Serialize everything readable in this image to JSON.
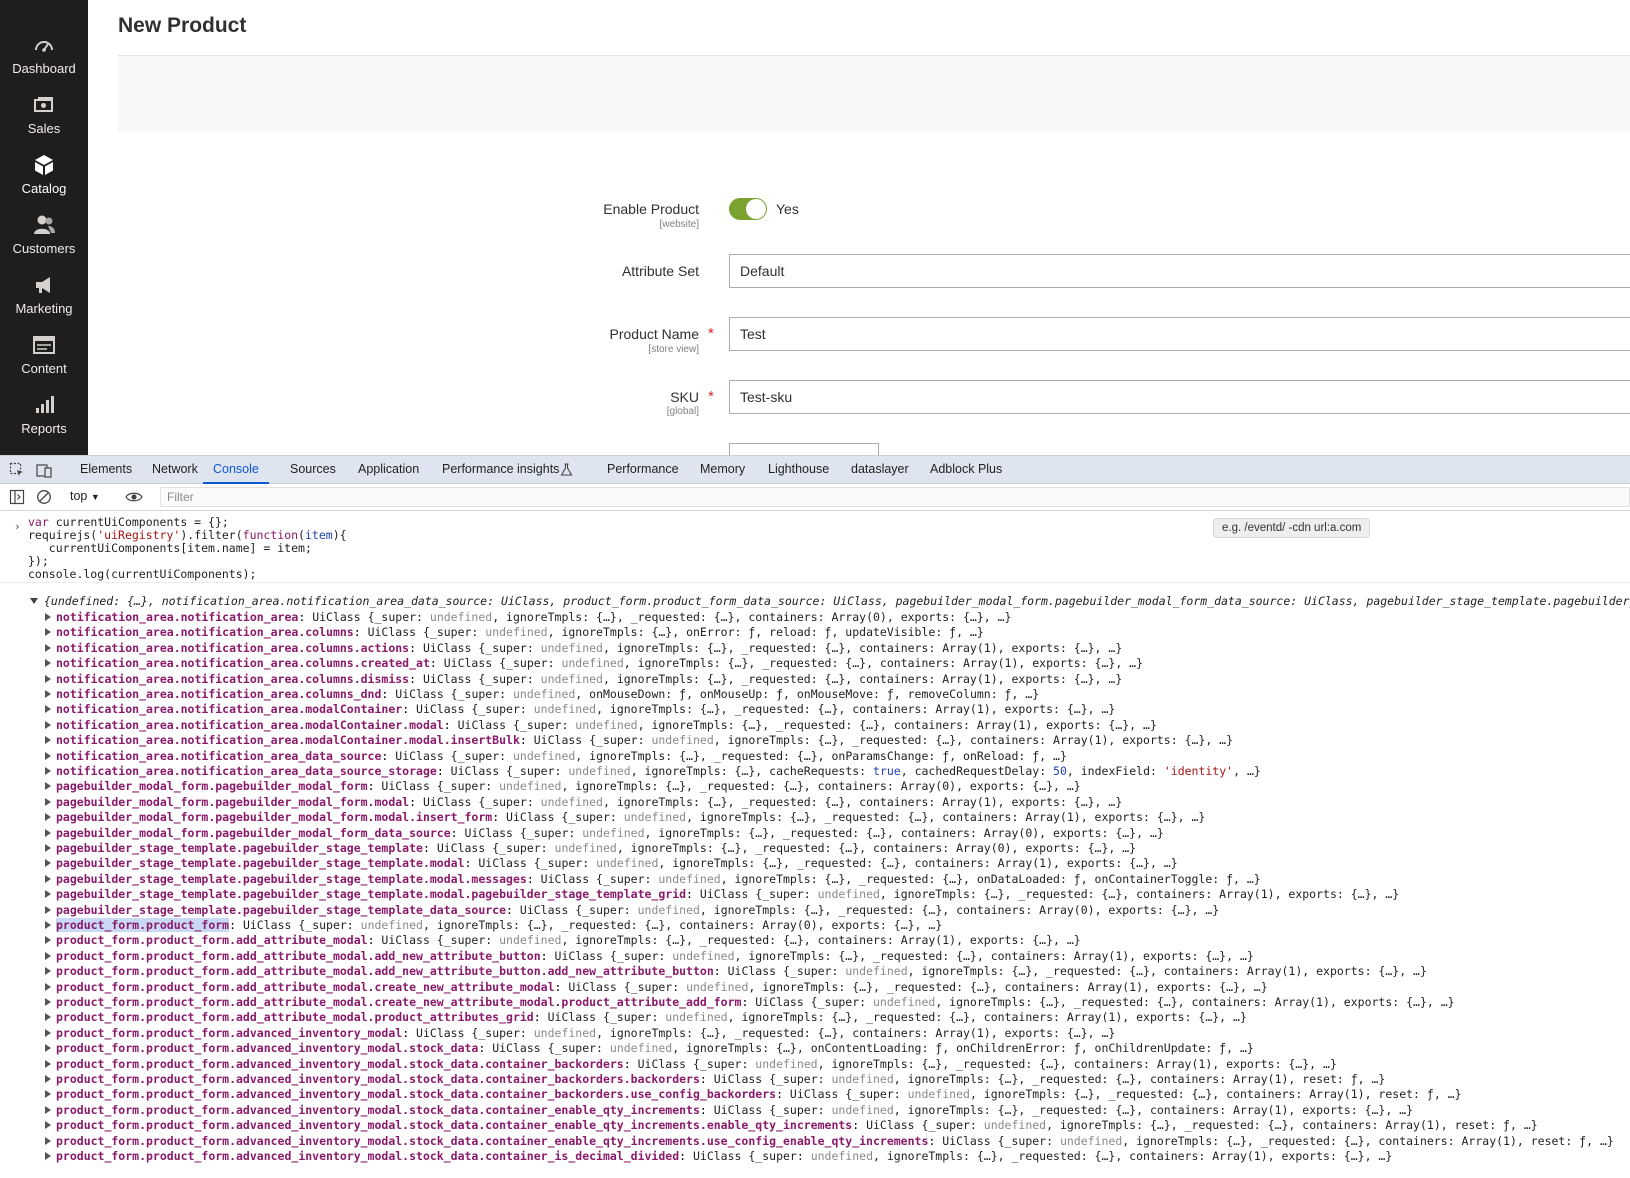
{
  "sidebar": {
    "items": [
      {
        "label": "Dashboard",
        "icon": "dashboard-icon"
      },
      {
        "label": "Sales",
        "icon": "sales-icon"
      },
      {
        "label": "Catalog",
        "icon": "catalog-icon"
      },
      {
        "label": "Customers",
        "icon": "customers-icon"
      },
      {
        "label": "Marketing",
        "icon": "marketing-icon"
      },
      {
        "label": "Content",
        "icon": "content-icon"
      },
      {
        "label": "Reports",
        "icon": "reports-icon"
      }
    ],
    "active": "Catalog"
  },
  "page": {
    "title": "New Product"
  },
  "form": {
    "enable_product": {
      "label": "Enable Product",
      "scope": "[website]",
      "value": "Yes",
      "on": true
    },
    "attribute_set": {
      "label": "Attribute Set",
      "value": "Default"
    },
    "product_name": {
      "label": "Product Name",
      "scope": "[store view]",
      "value": "Test",
      "required": "*"
    },
    "sku": {
      "label": "SKU",
      "scope": "[global]",
      "value": "Test-sku",
      "required": "*"
    }
  },
  "devtools": {
    "tabs": [
      "Elements",
      "Network",
      "Console",
      "Sources",
      "Application",
      "Performance insights",
      "Performance",
      "Memory",
      "Lighthouse",
      "dataslayer",
      "Adblock Plus"
    ],
    "active_tab": "Console",
    "context": "top",
    "filter_placeholder": "Filter",
    "filter_hint": "e.g. /eventd/ -cdn url:a.com",
    "command_lines": [
      "var currentUiComponents = {};",
      "requirejs('uiRegistry').filter(function(item){",
      "   currentUiComponents[item.name] = item;",
      "});",
      "console.log(currentUiComponents);"
    ],
    "result_summary": "{undefined: {…}, notification_area.notification_area_data_source: UiClass, product_form.product_form_data_source: UiClass, pagebuilder_modal_form.pagebuilder_modal_form_data_source: UiClass, pagebuilder_stage_template.pagebuilder_stage_temp",
    "entries": [
      {
        "key": "notification_area.notification_area",
        "value": "UiClass {_super: undefined, ignoreTmpls: {…}, _requested: {…}, containers: Array(0), exports: {…}, …}"
      },
      {
        "key": "notification_area.notification_area.columns",
        "value": "UiClass {_super: undefined, ignoreTmpls: {…}, onError: ƒ, reload: ƒ, updateVisible: ƒ, …}"
      },
      {
        "key": "notification_area.notification_area.columns.actions",
        "value": "UiClass {_super: undefined, ignoreTmpls: {…}, _requested: {…}, containers: Array(1), exports: {…}, …}"
      },
      {
        "key": "notification_area.notification_area.columns.created_at",
        "value": "UiClass {_super: undefined, ignoreTmpls: {…}, _requested: {…}, containers: Array(1), exports: {…}, …}"
      },
      {
        "key": "notification_area.notification_area.columns.dismiss",
        "value": "UiClass {_super: undefined, ignoreTmpls: {…}, _requested: {…}, containers: Array(1), exports: {…}, …}"
      },
      {
        "key": "notification_area.notification_area.columns_dnd",
        "value": "UiClass {_super: undefined, onMouseDown: ƒ, onMouseUp: ƒ, onMouseMove: ƒ, removeColumn: ƒ, …}"
      },
      {
        "key": "notification_area.notification_area.modalContainer",
        "value": "UiClass {_super: undefined, ignoreTmpls: {…}, _requested: {…}, containers: Array(1), exports: {…}, …}"
      },
      {
        "key": "notification_area.notification_area.modalContainer.modal",
        "value": "UiClass {_super: undefined, ignoreTmpls: {…}, _requested: {…}, containers: Array(1), exports: {…}, …}"
      },
      {
        "key": "notification_area.notification_area.modalContainer.modal.insertBulk",
        "value": "UiClass {_super: undefined, ignoreTmpls: {…}, _requested: {…}, containers: Array(1), exports: {…}, …}"
      },
      {
        "key": "notification_area.notification_area_data_source",
        "value": "UiClass {_super: undefined, ignoreTmpls: {…}, _requested: {…}, onParamsChange: ƒ, onReload: ƒ, …}"
      },
      {
        "key": "notification_area.notification_area_data_source_storage",
        "value": "UiClass {_super: undefined, ignoreTmpls: {…}, cacheRequests: true, cachedRequestDelay: 50, indexField: 'identity', …}"
      },
      {
        "key": "pagebuilder_modal_form.pagebuilder_modal_form",
        "value": "UiClass {_super: undefined, ignoreTmpls: {…}, _requested: {…}, containers: Array(0), exports: {…}, …}"
      },
      {
        "key": "pagebuilder_modal_form.pagebuilder_modal_form.modal",
        "value": "UiClass {_super: undefined, ignoreTmpls: {…}, _requested: {…}, containers: Array(1), exports: {…}, …}"
      },
      {
        "key": "pagebuilder_modal_form.pagebuilder_modal_form.modal.insert_form",
        "value": "UiClass {_super: undefined, ignoreTmpls: {…}, _requested: {…}, containers: Array(1), exports: {…}, …}"
      },
      {
        "key": "pagebuilder_modal_form.pagebuilder_modal_form_data_source",
        "value": "UiClass {_super: undefined, ignoreTmpls: {…}, _requested: {…}, containers: Array(0), exports: {…}, …}"
      },
      {
        "key": "pagebuilder_stage_template.pagebuilder_stage_template",
        "value": "UiClass {_super: undefined, ignoreTmpls: {…}, _requested: {…}, containers: Array(0), exports: {…}, …}"
      },
      {
        "key": "pagebuilder_stage_template.pagebuilder_stage_template.modal",
        "value": "UiClass {_super: undefined, ignoreTmpls: {…}, _requested: {…}, containers: Array(1), exports: {…}, …}"
      },
      {
        "key": "pagebuilder_stage_template.pagebuilder_stage_template.modal.messages",
        "value": "UiClass {_super: undefined, ignoreTmpls: {…}, _requested: {…}, onDataLoaded: ƒ, onContainerToggle: ƒ, …}"
      },
      {
        "key": "pagebuilder_stage_template.pagebuilder_stage_template.modal.pagebuilder_stage_template_grid",
        "value": "UiClass {_super: undefined, ignoreTmpls: {…}, _requested: {…}, containers: Array(1), exports: {…}, …}"
      },
      {
        "key": "pagebuilder_stage_template.pagebuilder_stage_template_data_source",
        "value": "UiClass {_super: undefined, ignoreTmpls: {…}, _requested: {…}, containers: Array(0), exports: {…}, …}"
      },
      {
        "key": "product_form.product_form",
        "value": "UiClass {_super: undefined, ignoreTmpls: {…}, _requested: {…}, containers: Array(0), exports: {…}, …}",
        "highlight": true
      },
      {
        "key": "product_form.product_form.add_attribute_modal",
        "value": "UiClass {_super: undefined, ignoreTmpls: {…}, _requested: {…}, containers: Array(1), exports: {…}, …}"
      },
      {
        "key": "product_form.product_form.add_attribute_modal.add_new_attribute_button",
        "value": "UiClass {_super: undefined, ignoreTmpls: {…}, _requested: {…}, containers: Array(1), exports: {…}, …}"
      },
      {
        "key": "product_form.product_form.add_attribute_modal.add_new_attribute_button.add_new_attribute_button",
        "value": "UiClass {_super: undefined, ignoreTmpls: {…}, _requested: {…}, containers: Array(1), exports: {…}, …}"
      },
      {
        "key": "product_form.product_form.add_attribute_modal.create_new_attribute_modal",
        "value": "UiClass {_super: undefined, ignoreTmpls: {…}, _requested: {…}, containers: Array(1), exports: {…}, …}"
      },
      {
        "key": "product_form.product_form.add_attribute_modal.create_new_attribute_modal.product_attribute_add_form",
        "value": "UiClass {_super: undefined, ignoreTmpls: {…}, _requested: {…}, containers: Array(1), exports: {…}, …}"
      },
      {
        "key": "product_form.product_form.add_attribute_modal.product_attributes_grid",
        "value": "UiClass {_super: undefined, ignoreTmpls: {…}, _requested: {…}, containers: Array(1), exports: {…}, …}"
      },
      {
        "key": "product_form.product_form.advanced_inventory_modal",
        "value": "UiClass {_super: undefined, ignoreTmpls: {…}, _requested: {…}, containers: Array(1), exports: {…}, …}"
      },
      {
        "key": "product_form.product_form.advanced_inventory_modal.stock_data",
        "value": "UiClass {_super: undefined, ignoreTmpls: {…}, onContentLoading: ƒ, onChildrenError: ƒ, onChildrenUpdate: ƒ, …}"
      },
      {
        "key": "product_form.product_form.advanced_inventory_modal.stock_data.container_backorders",
        "value": "UiClass {_super: undefined, ignoreTmpls: {…}, _requested: {…}, containers: Array(1), exports: {…}, …}"
      },
      {
        "key": "product_form.product_form.advanced_inventory_modal.stock_data.container_backorders.backorders",
        "value": "UiClass {_super: undefined, ignoreTmpls: {…}, _requested: {…}, containers: Array(1), reset: ƒ, …}"
      },
      {
        "key": "product_form.product_form.advanced_inventory_modal.stock_data.container_backorders.use_config_backorders",
        "value": "UiClass {_super: undefined, ignoreTmpls: {…}, _requested: {…}, containers: Array(1), reset: ƒ, …}"
      },
      {
        "key": "product_form.product_form.advanced_inventory_modal.stock_data.container_enable_qty_increments",
        "value": "UiClass {_super: undefined, ignoreTmpls: {…}, _requested: {…}, containers: Array(1), exports: {…}, …}"
      },
      {
        "key": "product_form.product_form.advanced_inventory_modal.stock_data.container_enable_qty_increments.enable_qty_increments",
        "value": "UiClass {_super: undefined, ignoreTmpls: {…}, _requested: {…}, containers: Array(1), reset: ƒ, …}"
      },
      {
        "key": "product_form.product_form.advanced_inventory_modal.stock_data.container_enable_qty_increments.use_config_enable_qty_increments",
        "value": "UiClass {_super: undefined, ignoreTmpls: {…}, _requested: {…}, containers: Array(1), reset: ƒ, …}"
      },
      {
        "key": "product_form.product_form.advanced_inventory_modal.stock_data.container_is_decimal_divided",
        "value": "UiClass {_super: undefined, ignoreTmpls: {…}, _requested: {…}, containers: Array(1), exports: {…}, …}"
      }
    ]
  }
}
